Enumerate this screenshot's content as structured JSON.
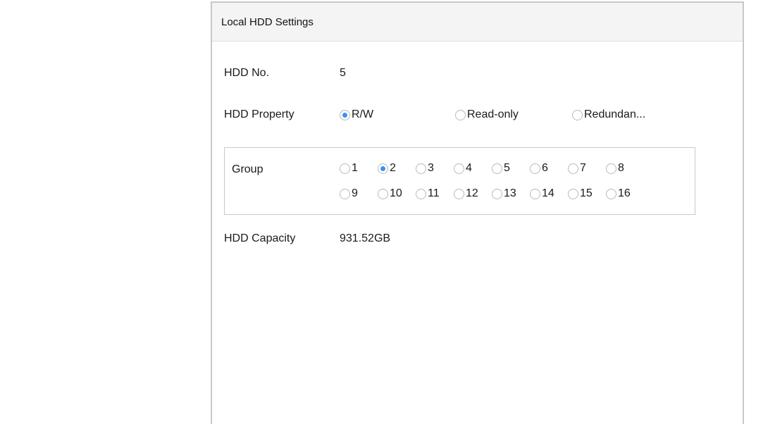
{
  "dialog": {
    "title": "Local HDD Settings"
  },
  "hdd_no": {
    "label": "HDD No.",
    "value": "5"
  },
  "hdd_property": {
    "label": "HDD Property",
    "options": [
      "R/W",
      "Read-only",
      "Redundan..."
    ],
    "selected": "R/W"
  },
  "group": {
    "label": "Group",
    "options": [
      "1",
      "2",
      "3",
      "4",
      "5",
      "6",
      "7",
      "8",
      "9",
      "10",
      "11",
      "12",
      "13",
      "14",
      "15",
      "16"
    ],
    "selected": "2"
  },
  "hdd_capacity": {
    "label": "HDD Capacity",
    "value": "931.52GB"
  },
  "colors": {
    "radio_selected": "#3e8ef7",
    "header_bg": "#f4f4f4",
    "border": "#c8c8c8"
  }
}
